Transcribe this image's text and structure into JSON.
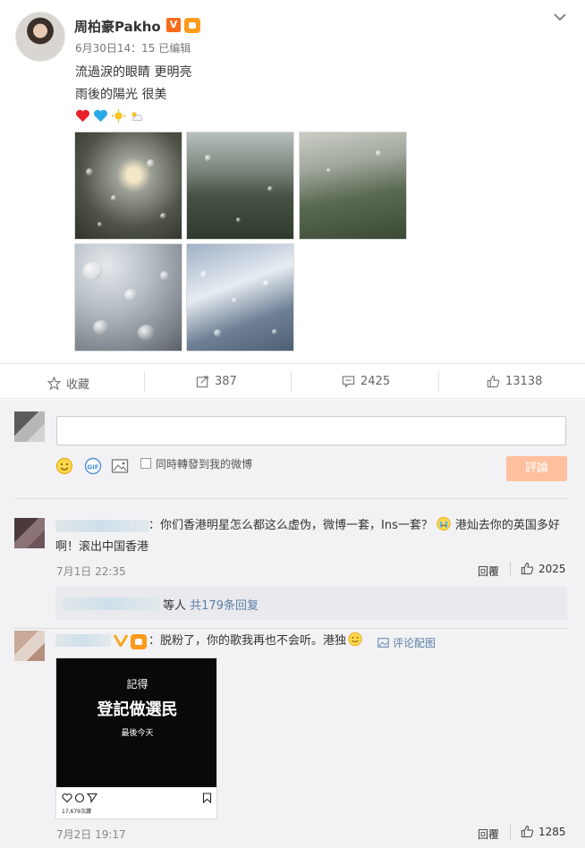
{
  "post": {
    "author": "周柏豪Pakho",
    "verified_badge": "V",
    "meta": "6月30日14：15  已编辑",
    "text_line1": "流過淚的眼睛 更明亮",
    "text_line2": "雨後的陽光 很美",
    "emojis": [
      "red-heart-icon",
      "blue-heart-icon",
      "sun-icon",
      "cloud-sun-icon"
    ]
  },
  "actions": {
    "favorite_label": "收藏",
    "repost_count": "387",
    "comment_count": "2425",
    "like_count": "13138"
  },
  "composer": {
    "placeholder": "",
    "repost_label": "同時轉發到我的微博",
    "submit_label": "評論"
  },
  "comments": [
    {
      "text_line1": "：你们香港明星怎么都这么虚伪，微博一套，Ins一套？",
      "text_line1b": "港灿去你的英国多好",
      "text_line2": "啊！滚出中国香港",
      "time": "7月1日 22:35",
      "reply_label": "回覆",
      "likes": "2025",
      "sub_prefix": "等人",
      "sub_link": "共179条回复"
    },
    {
      "text": "：脱粉了，你的歌我再也不会听。港独",
      "pic_label": "评论配图",
      "time": "7月2日 19:17",
      "reply_label": "回覆",
      "likes": "1285",
      "image": {
        "line1": "記得",
        "line2": "登記做選民",
        "line3": "最後今天",
        "likes_text": "17,679次讚"
      }
    }
  ],
  "colors": {
    "accent": "#eb7350",
    "link": "#5d7fa5",
    "submit_disabled": "#ffc09f",
    "heart_red": "#e7222b",
    "heart_blue": "#2aa8e6"
  }
}
